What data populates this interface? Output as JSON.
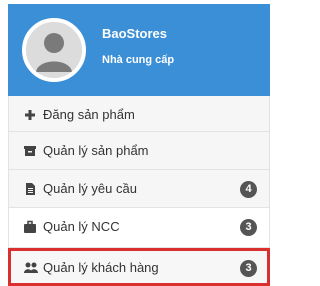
{
  "profile": {
    "store_name": "BaoStores",
    "role": "Nhà cung cấp",
    "avatar_icon": "user-avatar-icon"
  },
  "menu": {
    "items": [
      {
        "label": "Đăng sản phẩm",
        "icon": "plus-icon",
        "badge": ""
      },
      {
        "label": "Quản lý sản phẩm",
        "icon": "archive-box-icon",
        "badge": ""
      },
      {
        "label": "Quản lý yêu cầu",
        "icon": "document-icon",
        "badge": "4"
      },
      {
        "label": "Quản lý NCC",
        "icon": "briefcase-icon",
        "badge": "3"
      },
      {
        "label": "Quản lý khách hàng",
        "icon": "users-icon",
        "badge": "3"
      }
    ]
  },
  "colors": {
    "header_bg": "#3a8fd6",
    "highlight_border": "#d9302f",
    "badge_bg": "#555555"
  }
}
